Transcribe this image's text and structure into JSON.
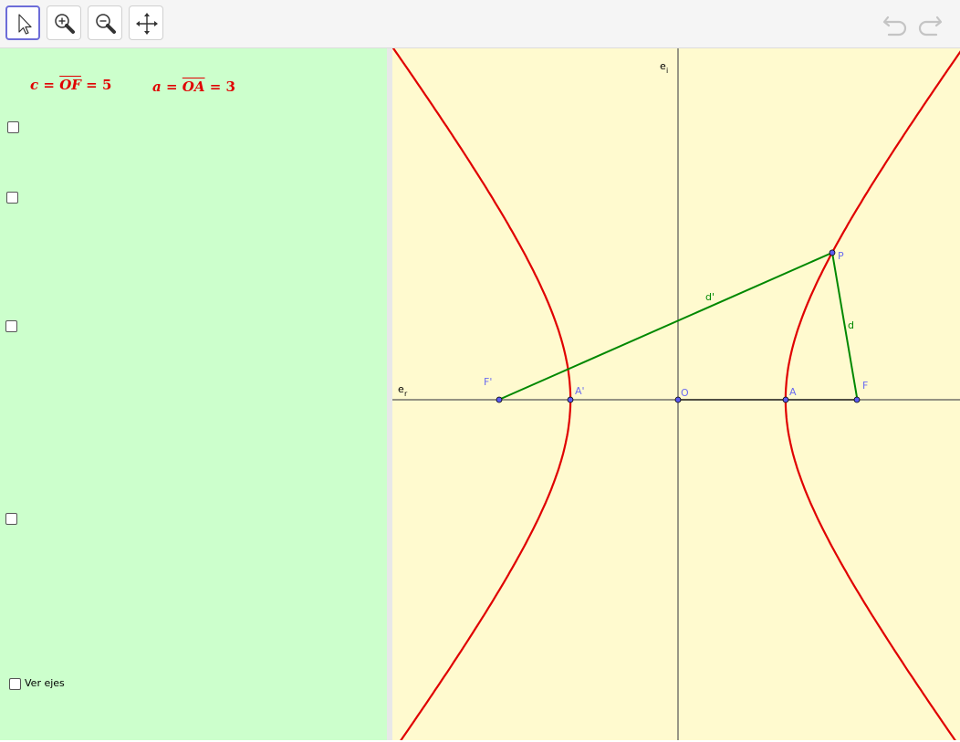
{
  "toolbar": {
    "tools": [
      {
        "name": "move",
        "icon": "cursor-arrow-icon",
        "active": true
      },
      {
        "name": "zoom-in",
        "icon": "zoom-in-icon",
        "active": false
      },
      {
        "name": "zoom-out",
        "icon": "zoom-out-icon",
        "active": false
      },
      {
        "name": "pan",
        "icon": "move-arrows-icon",
        "active": false
      }
    ],
    "undo_icon": "undo-icon",
    "redo_icon": "redo-icon"
  },
  "algebra": {
    "formula_c": {
      "var": "c",
      "eq1": "=",
      "seg": "OF",
      "eq2": "=",
      "value": "5"
    },
    "formula_a": {
      "var": "a",
      "eq1": "=",
      "seg": "OA",
      "eq2": "=",
      "value": "3"
    },
    "checkboxes": [
      {
        "label": "",
        "checked": false
      },
      {
        "label": "",
        "checked": false
      },
      {
        "label": "",
        "checked": false
      },
      {
        "label": "",
        "checked": false
      },
      {
        "label": "Ver ejes",
        "checked": false
      }
    ]
  },
  "graph": {
    "c": 5,
    "a": 3,
    "point_P": [
      4.3,
      4.1
    ],
    "points": {
      "F_prime": "F'",
      "A_prime": "A'",
      "O": "O",
      "A": "A",
      "F": "F",
      "P": "P"
    },
    "segments": {
      "d": "d",
      "d_prime": "d'"
    },
    "axes": {
      "real": "e",
      "real_sub": "r",
      "imag": "e",
      "imag_sub": "i"
    },
    "colors": {
      "hyperbola": "#e00000",
      "distances": "#008800",
      "points_fill": "#5c5cf0",
      "point_labels": "#6b6bf0",
      "axis": "#555555",
      "background": "#fffacf",
      "panel": "#ccffcc"
    }
  }
}
